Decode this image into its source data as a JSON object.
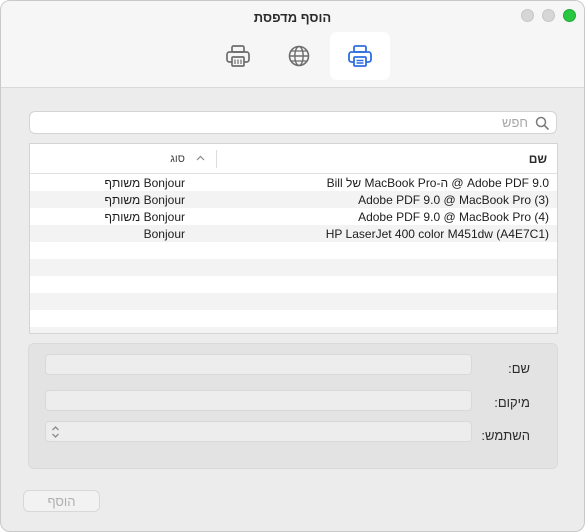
{
  "window": {
    "title": "הוסף מדפסת"
  },
  "toolbar": {
    "tabs": [
      {
        "icon": "printer-icon",
        "selected": true
      },
      {
        "icon": "globe-icon",
        "selected": false
      },
      {
        "icon": "fax-printer-icon",
        "selected": false
      }
    ]
  },
  "search": {
    "placeholder": "חפש",
    "value": ""
  },
  "table": {
    "columns": {
      "name": "שם",
      "type": "סוג"
    },
    "rows": [
      {
        "name": "Adobe PDF 9.0 @ ה-MacBook Pro של Bill",
        "type": "Bonjour משותף"
      },
      {
        "name": "Adobe PDF 9.0 @ MacBook Pro (3)",
        "type": "Bonjour משותף"
      },
      {
        "name": "Adobe PDF 9.0 @ MacBook Pro (4)",
        "type": "Bonjour משותף"
      },
      {
        "name": "HP LaserJet 400 color M451dw (A4E7C1)",
        "type": "Bonjour"
      }
    ]
  },
  "details": {
    "name_label": "שם:",
    "location_label": "מיקום:",
    "use_label": "השתמש:",
    "name_value": "",
    "location_value": "",
    "use_value": ""
  },
  "buttons": {
    "add_label": "הוסף"
  },
  "colors": {
    "accent": "#2f6fe0",
    "traffic_green": "#2ac840"
  }
}
